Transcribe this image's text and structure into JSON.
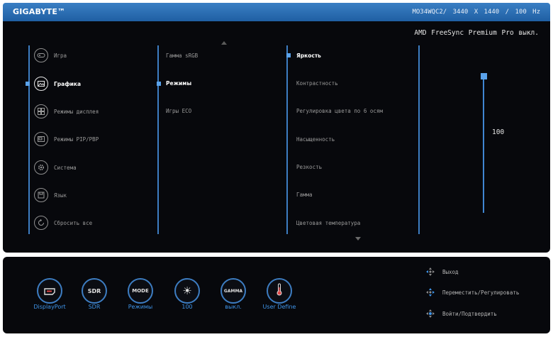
{
  "brand": "GIGABYTE™",
  "model_info": "MO34WQC2/ 3440 X 1440 / 100 Hz",
  "status_line": "AMD FreeSync Premium Pro выкл.",
  "main_menu": [
    {
      "label": "Игра",
      "icon": "gamepad-icon",
      "active": false
    },
    {
      "label": "Графика",
      "icon": "picture-icon",
      "active": true
    },
    {
      "label": "Режимы дисплея",
      "icon": "display-mode-icon",
      "active": false
    },
    {
      "label": "Режимы PIP/PBP",
      "icon": "pip-icon",
      "active": false
    },
    {
      "label": "Система",
      "icon": "gear-icon",
      "active": false
    },
    {
      "label": "Язык",
      "icon": "floppy-icon",
      "active": false
    },
    {
      "label": "Сбросить все",
      "icon": "reset-icon",
      "active": false
    }
  ],
  "sub_menu": [
    {
      "label": "Гамма sRGB",
      "active": false
    },
    {
      "label": "Режимы",
      "active": true
    },
    {
      "label": "Игры ECO",
      "active": false
    }
  ],
  "settings": [
    {
      "label": "Яркость",
      "active": true
    },
    {
      "label": "Контрастность",
      "active": false
    },
    {
      "label": "Регулировка цвета по 6 осям",
      "active": false
    },
    {
      "label": "Насыщенность",
      "active": false
    },
    {
      "label": "Резкость",
      "active": false
    },
    {
      "label": "Гамма",
      "active": false
    },
    {
      "label": "Цветовая температура",
      "active": false
    }
  ],
  "slider": {
    "value": "100",
    "level_percent": 100
  },
  "quick_buttons": [
    {
      "glyph": "▭",
      "icon": "displayport-icon",
      "label": "DisplayPort"
    },
    {
      "glyph": "SDR",
      "icon": "sdr-icon",
      "label": "SDR"
    },
    {
      "glyph": "MODE",
      "icon": "mode-icon",
      "label": "Режимы"
    },
    {
      "glyph": "☀",
      "icon": "brightness-icon",
      "label": "100"
    },
    {
      "glyph": "GAMMA",
      "icon": "gamma-icon",
      "label": "выкл."
    },
    {
      "glyph": "🌡",
      "icon": "thermometer-icon",
      "label": "User Define"
    }
  ],
  "hints": [
    {
      "label": "Выход",
      "icon": "joystick-left-icon"
    },
    {
      "label": "Переместить/Регулировать",
      "icon": "joystick-move-icon"
    },
    {
      "label": "Войти/Подтвердить",
      "icon": "joystick-press-icon"
    }
  ],
  "colors": {
    "accent": "#3d7dc2",
    "marker": "#5aa2ea",
    "panel": "#07080c",
    "topbar": "#2a6fb5"
  }
}
